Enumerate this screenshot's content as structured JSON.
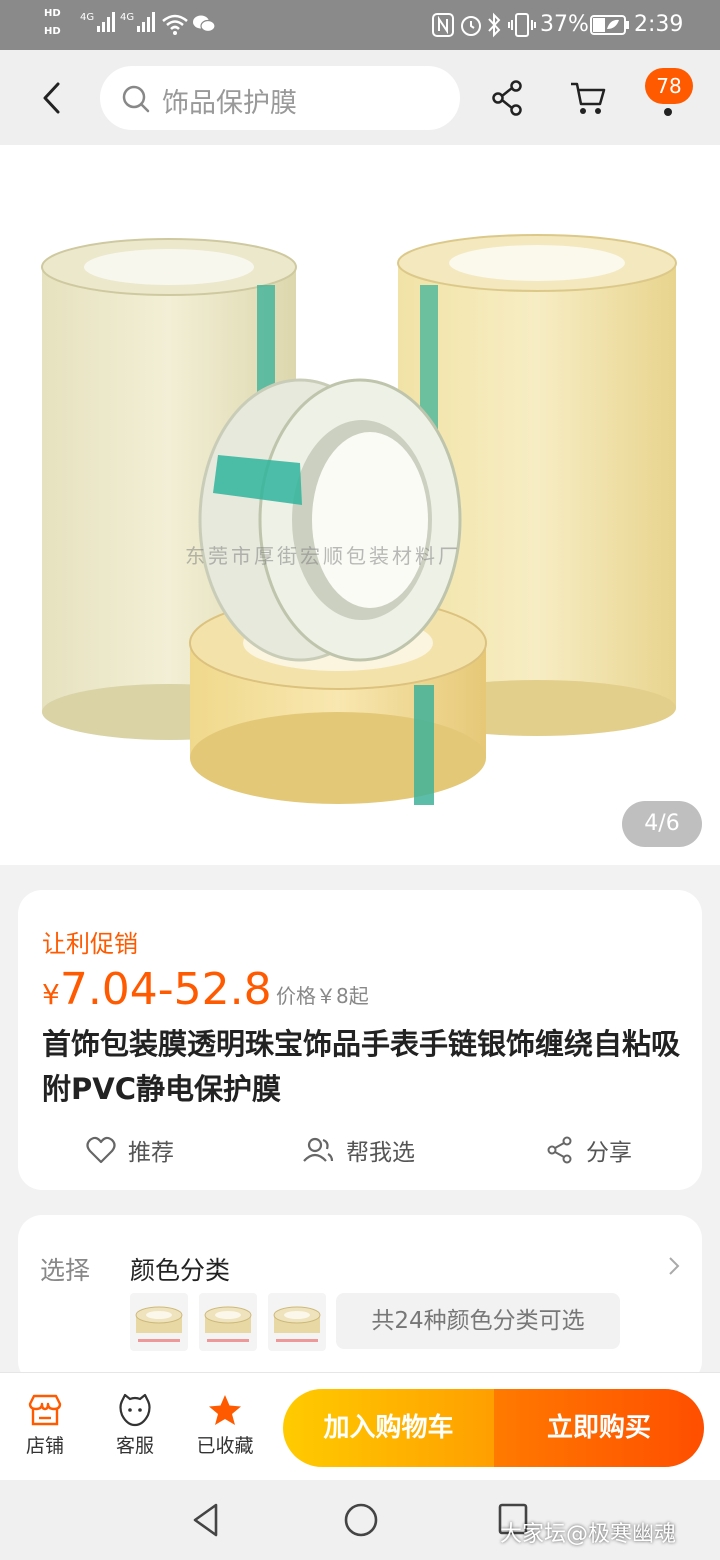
{
  "status_bar": {
    "hd1": "HD",
    "hd2": "HD",
    "net1": "4G",
    "net2": "4G",
    "battery": "37%",
    "time": "2:39"
  },
  "nav": {
    "search_placeholder": "饰品保护膜",
    "cart_badge": "78"
  },
  "gallery": {
    "watermark": "东莞市厚街宏顺包装材料厂",
    "counter": "4/6"
  },
  "product": {
    "promo_label": "让利促销",
    "price_symbol": "¥",
    "price_range": "7.04-52.8",
    "original_price": "价格￥8起",
    "title": "首饰包装膜透明珠宝饰品手表手链银饰缠绕自粘吸附PVC静电保护膜",
    "actions": {
      "recommend": "推荐",
      "help_choose": "帮我选",
      "share": "分享"
    }
  },
  "options": {
    "label": "选择",
    "value": "颜色分类",
    "more": "共24种颜色分类可选"
  },
  "bottom_bar": {
    "store": "店铺",
    "service": "客服",
    "favorited": "已收藏",
    "add_to_cart": "加入购物车",
    "buy_now": "立即购买"
  },
  "watermark_credit": "大家坛@极寒幽魂",
  "colors": {
    "accent": "#ff5a00",
    "cart_button": "#ffb300",
    "buy_button": "#ff5a00"
  }
}
